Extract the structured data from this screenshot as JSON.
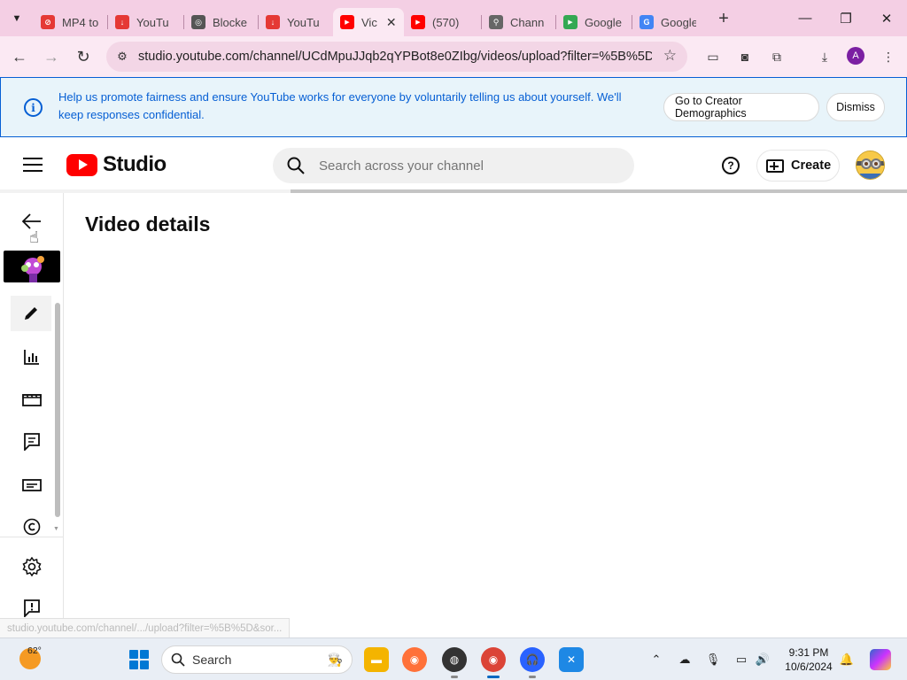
{
  "browser": {
    "tabs": [
      {
        "title": "MP4 to",
        "favicon_color": "#e53935",
        "favicon_char": "⊘"
      },
      {
        "title": "YouTu",
        "favicon_color": "#e53935",
        "favicon_char": "↓"
      },
      {
        "title": "Blocke",
        "favicon_color": "#555555",
        "favicon_char": "◎"
      },
      {
        "title": "YouTu",
        "favicon_color": "#e53935",
        "favicon_char": "↓"
      },
      {
        "title": "Vic",
        "favicon_color": "#ff0000",
        "favicon_char": "▶",
        "active": true
      },
      {
        "title": "(570)",
        "favicon_color": "#ff0000",
        "favicon_char": "▶"
      },
      {
        "title": "Chann",
        "favicon_color": "#666666",
        "favicon_char": "⚲"
      },
      {
        "title": "Google",
        "favicon_color": "#34a853",
        "favicon_char": "▶"
      },
      {
        "title": "Google",
        "favicon_color": "#4285f4",
        "favicon_char": "G"
      }
    ],
    "tab_close_glyph": "✕",
    "new_tab_glyph": "+",
    "window_controls": {
      "minimize": "—",
      "restore": "❐",
      "close": "✕"
    },
    "url": "studio.youtube.com/channel/UCdMpuJJqb2qYPBot8e0ZIbg/videos/upload?filter=%5B%5D...",
    "profile_initial": "A"
  },
  "banner": {
    "message": "Help us promote fairness and ensure YouTube works for everyone by voluntarily telling us about yourself. We'll keep responses confidential.",
    "primary_button": "Go to Creator Demographics",
    "dismiss_button": "Dismiss"
  },
  "header": {
    "logo_text": "Studio",
    "search_placeholder": "Search across your channel",
    "help_glyph": "?",
    "create_label": "Create"
  },
  "page": {
    "title": "Video details",
    "loading_progress_percent": 32
  },
  "sidebar": {
    "items": [
      "back",
      "thumbnail",
      "details",
      "analytics",
      "editor",
      "comments",
      "subtitles",
      "copyright",
      "settings",
      "feedback"
    ]
  },
  "status_bar": {
    "hover_url": "studio.youtube.com/channel/.../upload?filter=%5B%5D&sor..."
  },
  "taskbar": {
    "temperature": "62°",
    "search_label": "Search",
    "time": "9:31 PM",
    "date": "10/6/2024"
  },
  "colors": {
    "tab_strip": "#f4cfe4",
    "banner_text": "#065fd4",
    "youtube_red": "#ff0000"
  }
}
